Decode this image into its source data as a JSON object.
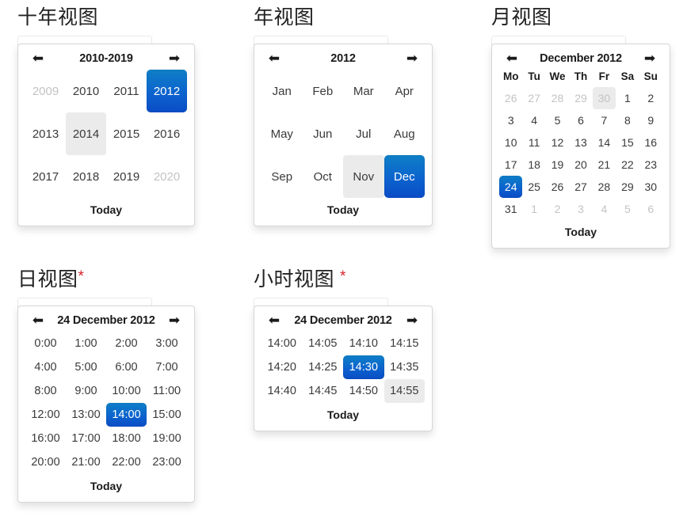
{
  "sections": [
    {
      "title": "十年视图",
      "required": false
    },
    {
      "title": "年视图",
      "required": false
    },
    {
      "title": "月视图",
      "required": false
    },
    {
      "title": "日视图",
      "required": true,
      "star": "*",
      "spaced": false
    },
    {
      "title": "小时视图",
      "required": true,
      "star": "*",
      "spaced": true
    }
  ],
  "colors": {
    "accent": "#0c63ce",
    "accent_top": "#0e7fc6",
    "accent_bottom": "#0a4cc6",
    "hover": "#ebebeb",
    "muted_text": "#c3c3c3",
    "text": "#3a3a3a",
    "required_star": "#d9232d",
    "panel_border": "#d6d6d6",
    "page_bg": "#ffffff"
  },
  "icons": {
    "prev": "⬅",
    "next": "➡"
  },
  "footer_label": "Today",
  "decade_view": {
    "header_title": "2010-2019",
    "prev_label": "⬅",
    "next_label": "➡",
    "footer": "Today",
    "cells": [
      {
        "label": "2009",
        "state": "muted"
      },
      {
        "label": "2010",
        "state": "normal"
      },
      {
        "label": "2011",
        "state": "normal"
      },
      {
        "label": "2012",
        "state": "active"
      },
      {
        "label": "2013",
        "state": "normal"
      },
      {
        "label": "2014",
        "state": "hover"
      },
      {
        "label": "2015",
        "state": "normal"
      },
      {
        "label": "2016",
        "state": "normal"
      },
      {
        "label": "2017",
        "state": "normal"
      },
      {
        "label": "2018",
        "state": "normal"
      },
      {
        "label": "2019",
        "state": "normal"
      },
      {
        "label": "2020",
        "state": "muted"
      }
    ]
  },
  "year_view": {
    "header_title": "2012",
    "prev_label": "⬅",
    "next_label": "➡",
    "footer": "Today",
    "cells": [
      {
        "label": "Jan",
        "state": "normal"
      },
      {
        "label": "Feb",
        "state": "normal"
      },
      {
        "label": "Mar",
        "state": "normal"
      },
      {
        "label": "Apr",
        "state": "normal"
      },
      {
        "label": "May",
        "state": "normal"
      },
      {
        "label": "Jun",
        "state": "normal"
      },
      {
        "label": "Jul",
        "state": "normal"
      },
      {
        "label": "Aug",
        "state": "normal"
      },
      {
        "label": "Sep",
        "state": "normal"
      },
      {
        "label": "Oct",
        "state": "normal"
      },
      {
        "label": "Nov",
        "state": "hover"
      },
      {
        "label": "Dec",
        "state": "active"
      }
    ]
  },
  "month_view": {
    "header_title": "December 2012",
    "prev_label": "⬅",
    "next_label": "➡",
    "footer": "Today",
    "weekdays": [
      "Mo",
      "Tu",
      "We",
      "Th",
      "Fr",
      "Sa",
      "Su"
    ],
    "cells": [
      {
        "label": "26",
        "state": "muted"
      },
      {
        "label": "27",
        "state": "muted"
      },
      {
        "label": "28",
        "state": "muted"
      },
      {
        "label": "29",
        "state": "muted"
      },
      {
        "label": "30",
        "state": "muted hover"
      },
      {
        "label": "1",
        "state": "normal"
      },
      {
        "label": "2",
        "state": "normal"
      },
      {
        "label": "3",
        "state": "normal"
      },
      {
        "label": "4",
        "state": "normal"
      },
      {
        "label": "5",
        "state": "normal"
      },
      {
        "label": "6",
        "state": "normal"
      },
      {
        "label": "7",
        "state": "normal"
      },
      {
        "label": "8",
        "state": "normal"
      },
      {
        "label": "9",
        "state": "normal"
      },
      {
        "label": "10",
        "state": "normal"
      },
      {
        "label": "11",
        "state": "normal"
      },
      {
        "label": "12",
        "state": "normal"
      },
      {
        "label": "13",
        "state": "normal"
      },
      {
        "label": "14",
        "state": "normal"
      },
      {
        "label": "15",
        "state": "normal"
      },
      {
        "label": "16",
        "state": "normal"
      },
      {
        "label": "17",
        "state": "normal"
      },
      {
        "label": "18",
        "state": "normal"
      },
      {
        "label": "19",
        "state": "normal"
      },
      {
        "label": "20",
        "state": "normal"
      },
      {
        "label": "21",
        "state": "normal"
      },
      {
        "label": "22",
        "state": "normal"
      },
      {
        "label": "23",
        "state": "normal"
      },
      {
        "label": "24",
        "state": "active"
      },
      {
        "label": "25",
        "state": "normal"
      },
      {
        "label": "26",
        "state": "normal"
      },
      {
        "label": "27",
        "state": "normal"
      },
      {
        "label": "28",
        "state": "normal"
      },
      {
        "label": "29",
        "state": "normal"
      },
      {
        "label": "30",
        "state": "normal"
      },
      {
        "label": "31",
        "state": "normal"
      },
      {
        "label": "1",
        "state": "muted"
      },
      {
        "label": "2",
        "state": "muted"
      },
      {
        "label": "3",
        "state": "muted"
      },
      {
        "label": "4",
        "state": "muted"
      },
      {
        "label": "5",
        "state": "muted"
      },
      {
        "label": "6",
        "state": "muted"
      }
    ]
  },
  "day_view": {
    "header_title": "24 December 2012",
    "prev_label": "⬅",
    "next_label": "➡",
    "footer": "Today",
    "cells": [
      {
        "label": "0:00",
        "state": "normal"
      },
      {
        "label": "1:00",
        "state": "normal"
      },
      {
        "label": "2:00",
        "state": "normal"
      },
      {
        "label": "3:00",
        "state": "normal"
      },
      {
        "label": "4:00",
        "state": "normal"
      },
      {
        "label": "5:00",
        "state": "normal"
      },
      {
        "label": "6:00",
        "state": "normal"
      },
      {
        "label": "7:00",
        "state": "normal"
      },
      {
        "label": "8:00",
        "state": "normal"
      },
      {
        "label": "9:00",
        "state": "normal"
      },
      {
        "label": "10:00",
        "state": "normal"
      },
      {
        "label": "11:00",
        "state": "normal"
      },
      {
        "label": "12:00",
        "state": "normal"
      },
      {
        "label": "13:00",
        "state": "normal"
      },
      {
        "label": "14:00",
        "state": "active"
      },
      {
        "label": "15:00",
        "state": "normal"
      },
      {
        "label": "16:00",
        "state": "normal"
      },
      {
        "label": "17:00",
        "state": "normal"
      },
      {
        "label": "18:00",
        "state": "normal"
      },
      {
        "label": "19:00",
        "state": "normal"
      },
      {
        "label": "20:00",
        "state": "normal"
      },
      {
        "label": "21:00",
        "state": "normal"
      },
      {
        "label": "22:00",
        "state": "normal"
      },
      {
        "label": "23:00",
        "state": "normal"
      }
    ]
  },
  "hour_view": {
    "header_title": "24 December 2012",
    "prev_label": "⬅",
    "next_label": "➡",
    "footer": "Today",
    "cells": [
      {
        "label": "14:00",
        "state": "normal"
      },
      {
        "label": "14:05",
        "state": "normal"
      },
      {
        "label": "14:10",
        "state": "normal"
      },
      {
        "label": "14:15",
        "state": "normal"
      },
      {
        "label": "14:20",
        "state": "normal"
      },
      {
        "label": "14:25",
        "state": "normal"
      },
      {
        "label": "14:30",
        "state": "active"
      },
      {
        "label": "14:35",
        "state": "normal"
      },
      {
        "label": "14:40",
        "state": "normal"
      },
      {
        "label": "14:45",
        "state": "normal"
      },
      {
        "label": "14:50",
        "state": "normal"
      },
      {
        "label": "14:55",
        "state": "hover"
      }
    ]
  }
}
